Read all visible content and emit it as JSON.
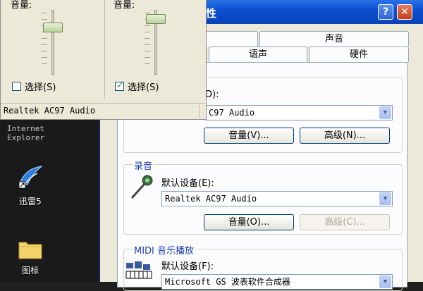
{
  "desktop": {
    "ie_label": "Internet\nExplorer",
    "icons": [
      {
        "label": "迅雷5"
      },
      {
        "label": "图标"
      }
    ]
  },
  "window": {
    "title": "性",
    "help_glyph": "?",
    "close_glyph": "✕",
    "tabs": [
      {
        "label": ""
      },
      {
        "label": "声音"
      },
      {
        "label": ""
      },
      {
        "label": "语声"
      },
      {
        "label": "硬件"
      }
    ],
    "playback": {
      "device_label_suffix": "D):",
      "device_value": "C97 Audio",
      "volume_button": "音量(V)...",
      "advanced_button": "高级(N)..."
    },
    "recording": {
      "group_title": "录音",
      "device_label": "默认设备(E):",
      "device_value": "Realtek AC97 Audio",
      "volume_button": "音量(O)...",
      "advanced_button": "高级(C)..."
    },
    "midi": {
      "group_title": "MIDI 音乐播放",
      "device_label": "默认设备(F):",
      "device_value": "Microsoft GS 波表软件合成器"
    }
  },
  "volume_control": {
    "columns": [
      {
        "title": "音量:",
        "select_label": "选择(S)",
        "checked": false,
        "level": 0.75
      },
      {
        "title": "音量:",
        "select_label": "选择(S)",
        "checked": true,
        "level": 0.8
      }
    ],
    "device": "Realtek AC97 Audio"
  },
  "colors": {
    "title_bar": "#0b4fd0",
    "group_title": "#1a3fb0"
  }
}
